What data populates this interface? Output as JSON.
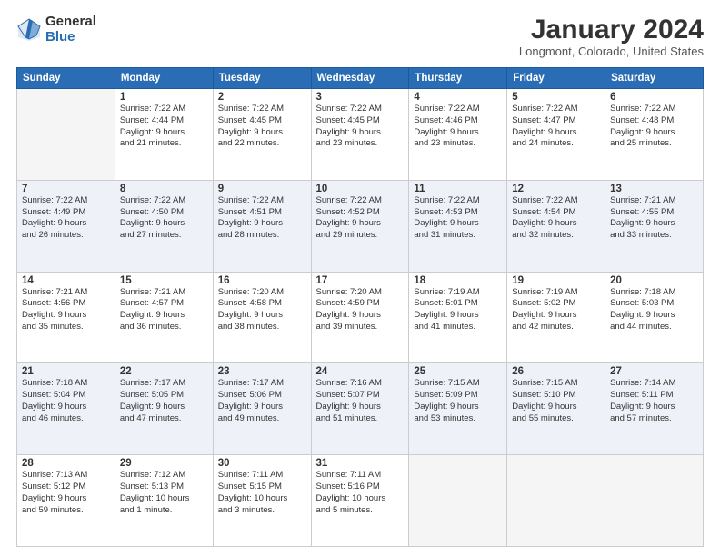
{
  "logo": {
    "general": "General",
    "blue": "Blue"
  },
  "header": {
    "month": "January 2024",
    "location": "Longmont, Colorado, United States"
  },
  "days_of_week": [
    "Sunday",
    "Monday",
    "Tuesday",
    "Wednesday",
    "Thursday",
    "Friday",
    "Saturday"
  ],
  "weeks": [
    [
      {
        "date": "",
        "info": ""
      },
      {
        "date": "1",
        "info": "Sunrise: 7:22 AM\nSunset: 4:44 PM\nDaylight: 9 hours\nand 21 minutes."
      },
      {
        "date": "2",
        "info": "Sunrise: 7:22 AM\nSunset: 4:45 PM\nDaylight: 9 hours\nand 22 minutes."
      },
      {
        "date": "3",
        "info": "Sunrise: 7:22 AM\nSunset: 4:45 PM\nDaylight: 9 hours\nand 23 minutes."
      },
      {
        "date": "4",
        "info": "Sunrise: 7:22 AM\nSunset: 4:46 PM\nDaylight: 9 hours\nand 23 minutes."
      },
      {
        "date": "5",
        "info": "Sunrise: 7:22 AM\nSunset: 4:47 PM\nDaylight: 9 hours\nand 24 minutes."
      },
      {
        "date": "6",
        "info": "Sunrise: 7:22 AM\nSunset: 4:48 PM\nDaylight: 9 hours\nand 25 minutes."
      }
    ],
    [
      {
        "date": "7",
        "info": "Sunrise: 7:22 AM\nSunset: 4:49 PM\nDaylight: 9 hours\nand 26 minutes."
      },
      {
        "date": "8",
        "info": "Sunrise: 7:22 AM\nSunset: 4:50 PM\nDaylight: 9 hours\nand 27 minutes."
      },
      {
        "date": "9",
        "info": "Sunrise: 7:22 AM\nSunset: 4:51 PM\nDaylight: 9 hours\nand 28 minutes."
      },
      {
        "date": "10",
        "info": "Sunrise: 7:22 AM\nSunset: 4:52 PM\nDaylight: 9 hours\nand 29 minutes."
      },
      {
        "date": "11",
        "info": "Sunrise: 7:22 AM\nSunset: 4:53 PM\nDaylight: 9 hours\nand 31 minutes."
      },
      {
        "date": "12",
        "info": "Sunrise: 7:22 AM\nSunset: 4:54 PM\nDaylight: 9 hours\nand 32 minutes."
      },
      {
        "date": "13",
        "info": "Sunrise: 7:21 AM\nSunset: 4:55 PM\nDaylight: 9 hours\nand 33 minutes."
      }
    ],
    [
      {
        "date": "14",
        "info": "Sunrise: 7:21 AM\nSunset: 4:56 PM\nDaylight: 9 hours\nand 35 minutes."
      },
      {
        "date": "15",
        "info": "Sunrise: 7:21 AM\nSunset: 4:57 PM\nDaylight: 9 hours\nand 36 minutes."
      },
      {
        "date": "16",
        "info": "Sunrise: 7:20 AM\nSunset: 4:58 PM\nDaylight: 9 hours\nand 38 minutes."
      },
      {
        "date": "17",
        "info": "Sunrise: 7:20 AM\nSunset: 4:59 PM\nDaylight: 9 hours\nand 39 minutes."
      },
      {
        "date": "18",
        "info": "Sunrise: 7:19 AM\nSunset: 5:01 PM\nDaylight: 9 hours\nand 41 minutes."
      },
      {
        "date": "19",
        "info": "Sunrise: 7:19 AM\nSunset: 5:02 PM\nDaylight: 9 hours\nand 42 minutes."
      },
      {
        "date": "20",
        "info": "Sunrise: 7:18 AM\nSunset: 5:03 PM\nDaylight: 9 hours\nand 44 minutes."
      }
    ],
    [
      {
        "date": "21",
        "info": "Sunrise: 7:18 AM\nSunset: 5:04 PM\nDaylight: 9 hours\nand 46 minutes."
      },
      {
        "date": "22",
        "info": "Sunrise: 7:17 AM\nSunset: 5:05 PM\nDaylight: 9 hours\nand 47 minutes."
      },
      {
        "date": "23",
        "info": "Sunrise: 7:17 AM\nSunset: 5:06 PM\nDaylight: 9 hours\nand 49 minutes."
      },
      {
        "date": "24",
        "info": "Sunrise: 7:16 AM\nSunset: 5:07 PM\nDaylight: 9 hours\nand 51 minutes."
      },
      {
        "date": "25",
        "info": "Sunrise: 7:15 AM\nSunset: 5:09 PM\nDaylight: 9 hours\nand 53 minutes."
      },
      {
        "date": "26",
        "info": "Sunrise: 7:15 AM\nSunset: 5:10 PM\nDaylight: 9 hours\nand 55 minutes."
      },
      {
        "date": "27",
        "info": "Sunrise: 7:14 AM\nSunset: 5:11 PM\nDaylight: 9 hours\nand 57 minutes."
      }
    ],
    [
      {
        "date": "28",
        "info": "Sunrise: 7:13 AM\nSunset: 5:12 PM\nDaylight: 9 hours\nand 59 minutes."
      },
      {
        "date": "29",
        "info": "Sunrise: 7:12 AM\nSunset: 5:13 PM\nDaylight: 10 hours\nand 1 minute."
      },
      {
        "date": "30",
        "info": "Sunrise: 7:11 AM\nSunset: 5:15 PM\nDaylight: 10 hours\nand 3 minutes."
      },
      {
        "date": "31",
        "info": "Sunrise: 7:11 AM\nSunset: 5:16 PM\nDaylight: 10 hours\nand 5 minutes."
      },
      {
        "date": "",
        "info": ""
      },
      {
        "date": "",
        "info": ""
      },
      {
        "date": "",
        "info": ""
      }
    ]
  ]
}
